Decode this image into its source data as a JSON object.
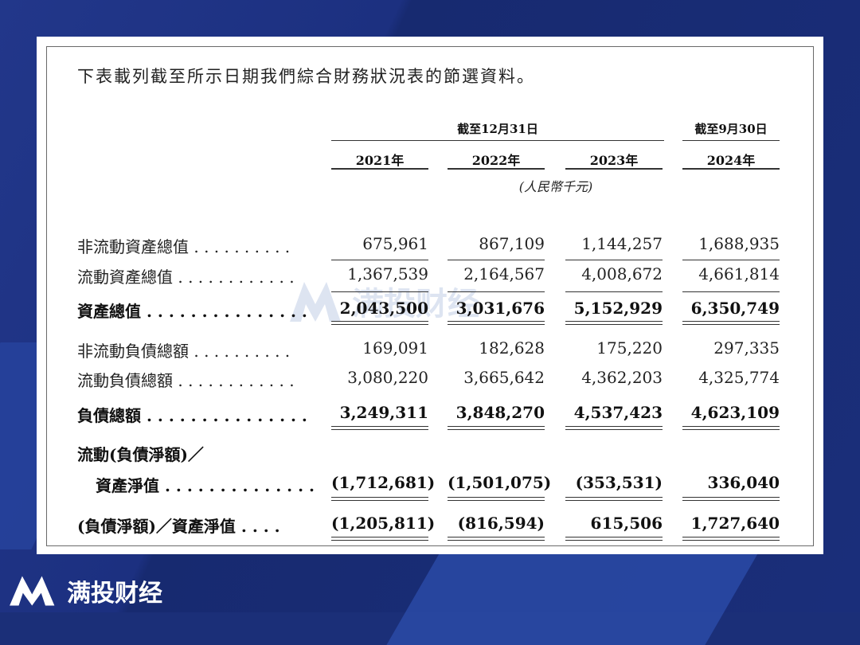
{
  "intro": "下表載列截至所示日期我們綜合財務狀況表的節選資料。",
  "periods": [
    {
      "label": "截至12月31日"
    },
    {
      "label": "截至9月30日"
    }
  ],
  "years": [
    "2021年",
    "2022年",
    "2023年",
    "2024年"
  ],
  "unit": "(人民幣千元)",
  "rows": [
    {
      "label": "非流動資產總值",
      "leader": " . . . . . . . . . .",
      "values": [
        "675,961",
        "867,109",
        "1,144,257",
        "1,688,935"
      ],
      "bold": false
    },
    {
      "label": "流動資產總值",
      "leader": " . . . . . . . . . . . .",
      "values": [
        "1,367,539",
        "2,164,567",
        "4,008,672",
        "4,661,814"
      ],
      "bold": false
    },
    {
      "label": "資產總值",
      "leader": " . . . . . . . . . . . . . . .",
      "values": [
        "2,043,500",
        "3,031,676",
        "5,152,929",
        "6,350,749"
      ],
      "bold": true
    },
    {
      "label": "非流動負債總額",
      "leader": " . . . . . . . . . .",
      "values": [
        "169,091",
        "182,628",
        "175,220",
        "297,335"
      ],
      "bold": false
    },
    {
      "label": "流動負債總額",
      "leader": " . . . . . . . . . . . .",
      "values": [
        "3,080,220",
        "3,665,642",
        "4,362,203",
        "4,325,774"
      ],
      "bold": false
    },
    {
      "label": "負債總額",
      "leader": " . . . . . . . . . . . . . . .",
      "values": [
        "3,249,311",
        "3,848,270",
        "4,537,423",
        "4,623,109"
      ],
      "bold": true
    },
    {
      "label": "流動(負債淨額)／",
      "leader": "",
      "values": [
        "",
        "",
        "",
        ""
      ],
      "bold": true
    },
    {
      "label": "資產淨值",
      "leader": " . . . . . . . . . . . . . .",
      "values": [
        "(1,712,681)",
        "(1,501,075)",
        "(353,531)",
        "336,040"
      ],
      "bold": true
    },
    {
      "label": "(負債淨額)／資產淨值",
      "leader": " . . . .",
      "values": [
        "(1,205,811)",
        "(816,594)",
        "615,506",
        "1,727,640"
      ],
      "bold": true
    }
  ],
  "watermark": {
    "text": "满投财经",
    "logo_icon": "brand-m-logo-icon"
  },
  "brand": {
    "text": "满投财经",
    "logo_icon": "brand-m-logo-icon"
  },
  "colors": {
    "background": "#1b2f78",
    "paper": "#ffffff",
    "text": "#222222",
    "brand": "#ffffff"
  }
}
